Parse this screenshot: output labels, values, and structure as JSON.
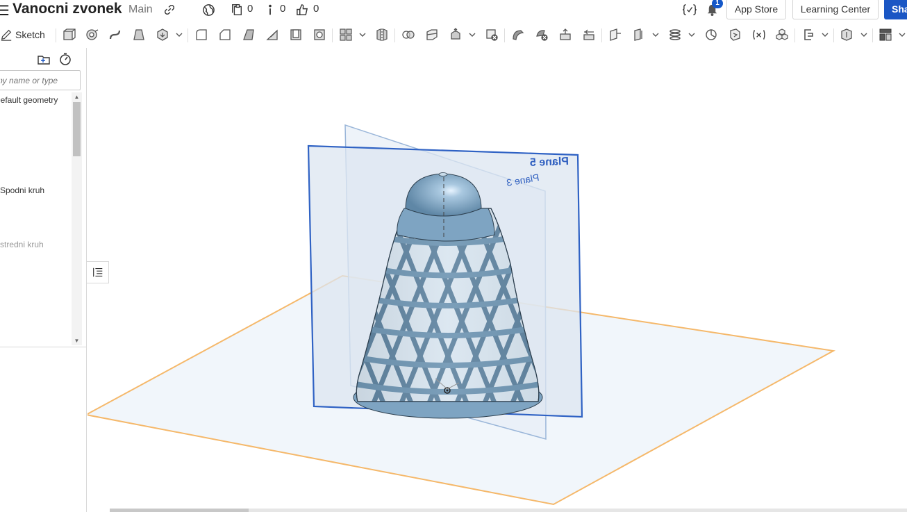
{
  "app": {
    "document_title": "Vanocni zvonek",
    "branch": "Main"
  },
  "topbar": {
    "icons": [
      "menu-icon",
      "link-icon",
      "globe-icon",
      "versions-icon",
      "info-icon",
      "like-icon",
      "variable-icon",
      "bell-icon"
    ],
    "versions_count": "0",
    "info_count": "0",
    "likes_count": "0",
    "notification_count": "1",
    "app_store_label": "App Store",
    "learning_center_label": "Learning Center",
    "share_label": "Share"
  },
  "toolbar": {
    "sketch_label": "Sketch",
    "tools": [
      "sketch-pencil-icon",
      "extrude-icon",
      "revolve-icon",
      "sweep-icon",
      "loft-icon",
      "thicken-icon",
      "fillet-icon",
      "chamfer-icon",
      "draft-icon",
      "rib-icon",
      "shell-icon",
      "hole-icon",
      "pattern-icon",
      "mirror-icon",
      "boolean-icon",
      "split-icon",
      "transform-icon",
      "delete-part-icon",
      "modify-fillet-icon",
      "delete-face-icon",
      "move-face-icon",
      "replace-face-icon",
      "plane-icon",
      "mate-connector-icon",
      "helix-icon",
      "measure-icon",
      "section-icon",
      "variable-fx-icon",
      "parts-icon",
      "sheet-metal-icon",
      "frame-icon",
      "surface-icon"
    ]
  },
  "feature_panel": {
    "search_placeholder": "Filter by name or type",
    "items": [
      {
        "label": "Default geometry",
        "muted": false
      },
      {
        "label": "Spodni kruh",
        "muted": false
      },
      {
        "label": "stredni kruh",
        "muted": true
      }
    ]
  },
  "viewport": {
    "plane_labels": [
      "Plane 5",
      "Plane 3"
    ],
    "colors": {
      "top_plane_edge": "#f5b86a",
      "plane_fill": "#e8f0f8",
      "front_plane_edge": "#2f62c4",
      "bell_body": "#8fb3cf",
      "bell_dark": "#4e6c84",
      "plane_label": "#3060c0"
    }
  }
}
